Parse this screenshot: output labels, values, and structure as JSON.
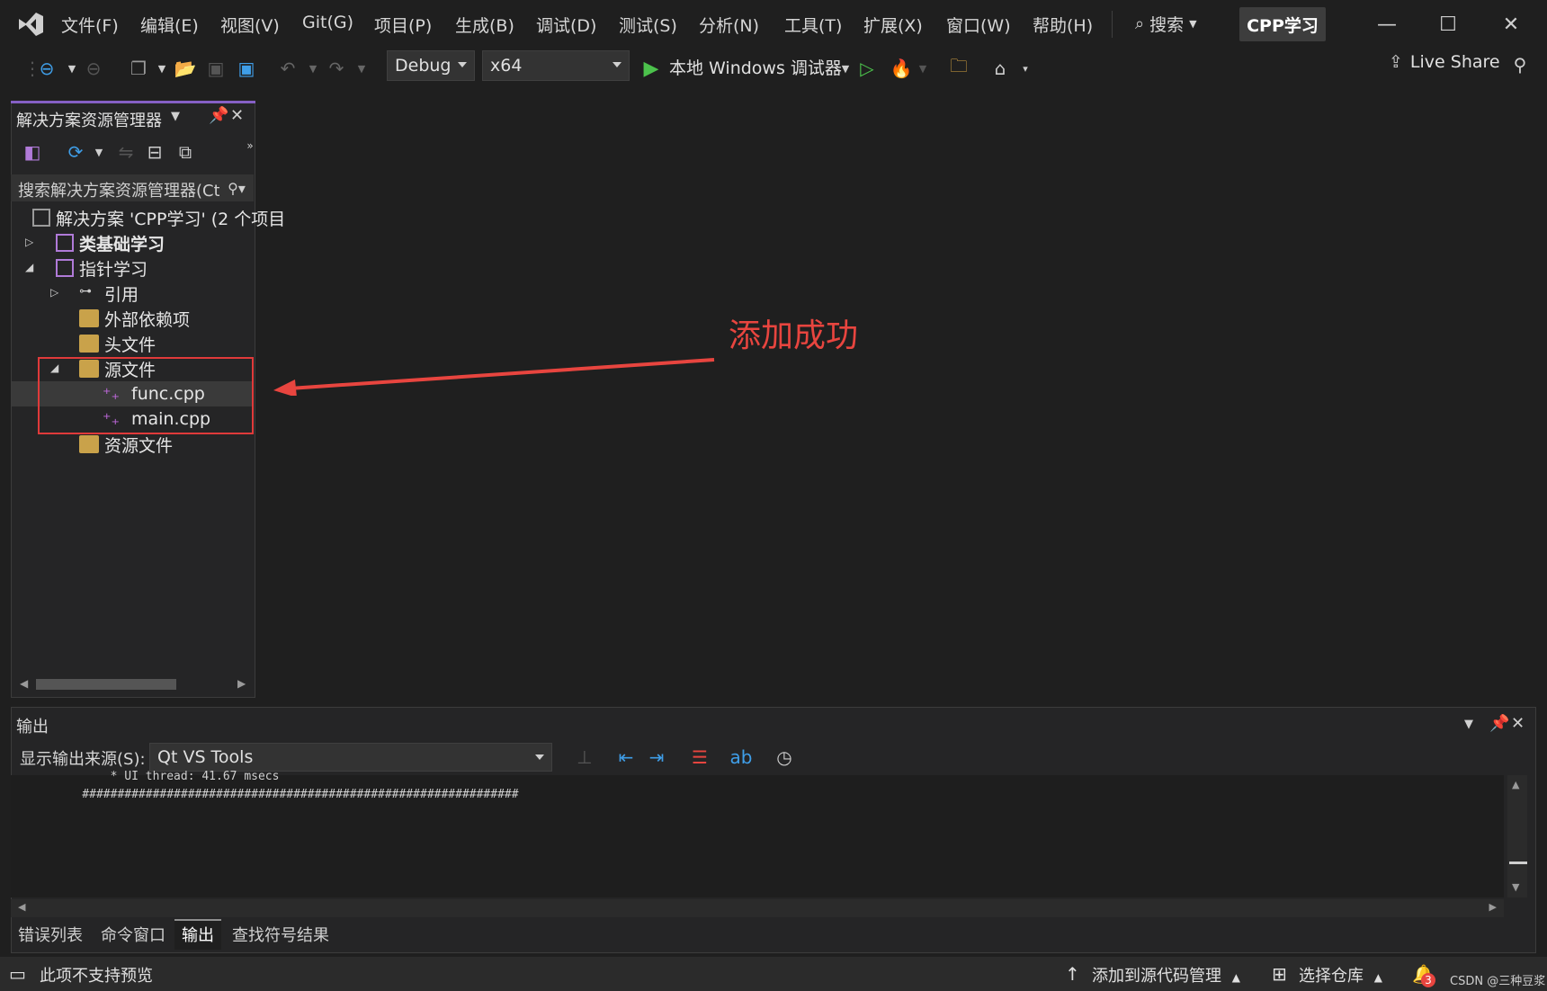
{
  "menu": {
    "items": [
      "文件(F)",
      "编辑(E)",
      "视图(V)",
      "Git(G)",
      "项目(P)",
      "生成(B)",
      "调试(D)",
      "测试(S)",
      "分析(N)",
      "工具(T)",
      "扩展(X)",
      "窗口(W)",
      "帮助(H)"
    ],
    "search_label": "搜索",
    "solution_badge": "CPP学习"
  },
  "toolbar": {
    "configuration": "Debug",
    "platform": "x64",
    "run_target": "本地 Windows 调试器",
    "live_share": "Live Share"
  },
  "solution_explorer": {
    "title": "解决方案资源管理器",
    "search_placeholder": "搜索解决方案资源管理器(Ctrl+;)",
    "tree": {
      "solution": "解决方案 'CPP学习' (2 个项目",
      "project1": "类基础学习",
      "project2": "指针学习",
      "references": "引用",
      "external_deps": "外部依赖项",
      "header_files": "头文件",
      "source_files": "源文件",
      "file1": "func.cpp",
      "file2": "main.cpp",
      "resource_files": "资源文件"
    }
  },
  "annotation": {
    "text": "添加成功",
    "color": "#e8453f"
  },
  "output": {
    "title": "输出",
    "source_label": "显示输出来源(S):",
    "source_value": "Qt VS Tools",
    "lines": [
      "        * UI thread: 41.67 msecs",
      "    ##############################################################"
    ]
  },
  "bottom_tabs": [
    "错误列表",
    "命令窗口",
    "输出",
    "查找符号结果"
  ],
  "status_bar": {
    "left": "此项不支持预览",
    "add_source_control": "添加到源代码管理",
    "select_repo": "选择仓库",
    "notifications": "3",
    "watermark": "CSDN @三种豆浆"
  }
}
